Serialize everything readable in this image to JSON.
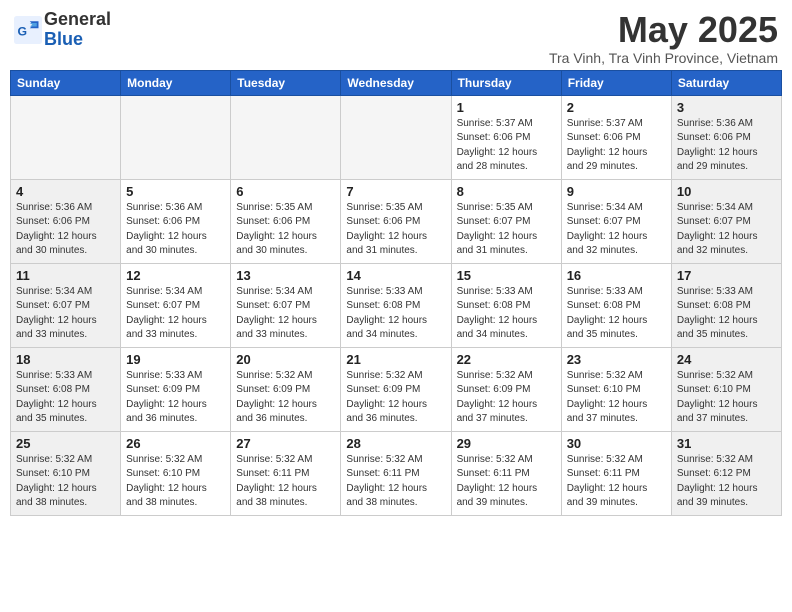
{
  "header": {
    "logo_line1": "General",
    "logo_line2": "Blue",
    "month_year": "May 2025",
    "location": "Tra Vinh, Tra Vinh Province, Vietnam"
  },
  "days_of_week": [
    "Sunday",
    "Monday",
    "Tuesday",
    "Wednesday",
    "Thursday",
    "Friday",
    "Saturday"
  ],
  "weeks": [
    [
      {
        "num": "",
        "info": ""
      },
      {
        "num": "",
        "info": ""
      },
      {
        "num": "",
        "info": ""
      },
      {
        "num": "",
        "info": ""
      },
      {
        "num": "1",
        "info": "Sunrise: 5:37 AM\nSunset: 6:06 PM\nDaylight: 12 hours\nand 28 minutes."
      },
      {
        "num": "2",
        "info": "Sunrise: 5:37 AM\nSunset: 6:06 PM\nDaylight: 12 hours\nand 29 minutes."
      },
      {
        "num": "3",
        "info": "Sunrise: 5:36 AM\nSunset: 6:06 PM\nDaylight: 12 hours\nand 29 minutes."
      }
    ],
    [
      {
        "num": "4",
        "info": "Sunrise: 5:36 AM\nSunset: 6:06 PM\nDaylight: 12 hours\nand 30 minutes."
      },
      {
        "num": "5",
        "info": "Sunrise: 5:36 AM\nSunset: 6:06 PM\nDaylight: 12 hours\nand 30 minutes."
      },
      {
        "num": "6",
        "info": "Sunrise: 5:35 AM\nSunset: 6:06 PM\nDaylight: 12 hours\nand 30 minutes."
      },
      {
        "num": "7",
        "info": "Sunrise: 5:35 AM\nSunset: 6:06 PM\nDaylight: 12 hours\nand 31 minutes."
      },
      {
        "num": "8",
        "info": "Sunrise: 5:35 AM\nSunset: 6:07 PM\nDaylight: 12 hours\nand 31 minutes."
      },
      {
        "num": "9",
        "info": "Sunrise: 5:34 AM\nSunset: 6:07 PM\nDaylight: 12 hours\nand 32 minutes."
      },
      {
        "num": "10",
        "info": "Sunrise: 5:34 AM\nSunset: 6:07 PM\nDaylight: 12 hours\nand 32 minutes."
      }
    ],
    [
      {
        "num": "11",
        "info": "Sunrise: 5:34 AM\nSunset: 6:07 PM\nDaylight: 12 hours\nand 33 minutes."
      },
      {
        "num": "12",
        "info": "Sunrise: 5:34 AM\nSunset: 6:07 PM\nDaylight: 12 hours\nand 33 minutes."
      },
      {
        "num": "13",
        "info": "Sunrise: 5:34 AM\nSunset: 6:07 PM\nDaylight: 12 hours\nand 33 minutes."
      },
      {
        "num": "14",
        "info": "Sunrise: 5:33 AM\nSunset: 6:08 PM\nDaylight: 12 hours\nand 34 minutes."
      },
      {
        "num": "15",
        "info": "Sunrise: 5:33 AM\nSunset: 6:08 PM\nDaylight: 12 hours\nand 34 minutes."
      },
      {
        "num": "16",
        "info": "Sunrise: 5:33 AM\nSunset: 6:08 PM\nDaylight: 12 hours\nand 35 minutes."
      },
      {
        "num": "17",
        "info": "Sunrise: 5:33 AM\nSunset: 6:08 PM\nDaylight: 12 hours\nand 35 minutes."
      }
    ],
    [
      {
        "num": "18",
        "info": "Sunrise: 5:33 AM\nSunset: 6:08 PM\nDaylight: 12 hours\nand 35 minutes."
      },
      {
        "num": "19",
        "info": "Sunrise: 5:33 AM\nSunset: 6:09 PM\nDaylight: 12 hours\nand 36 minutes."
      },
      {
        "num": "20",
        "info": "Sunrise: 5:32 AM\nSunset: 6:09 PM\nDaylight: 12 hours\nand 36 minutes."
      },
      {
        "num": "21",
        "info": "Sunrise: 5:32 AM\nSunset: 6:09 PM\nDaylight: 12 hours\nand 36 minutes."
      },
      {
        "num": "22",
        "info": "Sunrise: 5:32 AM\nSunset: 6:09 PM\nDaylight: 12 hours\nand 37 minutes."
      },
      {
        "num": "23",
        "info": "Sunrise: 5:32 AM\nSunset: 6:10 PM\nDaylight: 12 hours\nand 37 minutes."
      },
      {
        "num": "24",
        "info": "Sunrise: 5:32 AM\nSunset: 6:10 PM\nDaylight: 12 hours\nand 37 minutes."
      }
    ],
    [
      {
        "num": "25",
        "info": "Sunrise: 5:32 AM\nSunset: 6:10 PM\nDaylight: 12 hours\nand 38 minutes."
      },
      {
        "num": "26",
        "info": "Sunrise: 5:32 AM\nSunset: 6:10 PM\nDaylight: 12 hours\nand 38 minutes."
      },
      {
        "num": "27",
        "info": "Sunrise: 5:32 AM\nSunset: 6:11 PM\nDaylight: 12 hours\nand 38 minutes."
      },
      {
        "num": "28",
        "info": "Sunrise: 5:32 AM\nSunset: 6:11 PM\nDaylight: 12 hours\nand 38 minutes."
      },
      {
        "num": "29",
        "info": "Sunrise: 5:32 AM\nSunset: 6:11 PM\nDaylight: 12 hours\nand 39 minutes."
      },
      {
        "num": "30",
        "info": "Sunrise: 5:32 AM\nSunset: 6:11 PM\nDaylight: 12 hours\nand 39 minutes."
      },
      {
        "num": "31",
        "info": "Sunrise: 5:32 AM\nSunset: 6:12 PM\nDaylight: 12 hours\nand 39 minutes."
      }
    ]
  ]
}
